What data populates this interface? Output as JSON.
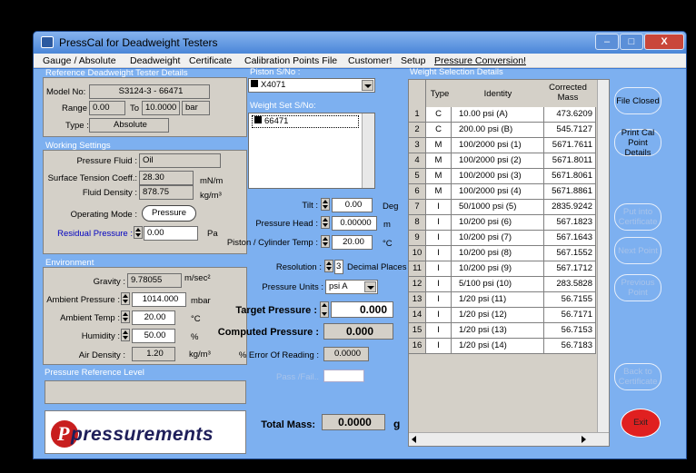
{
  "window": {
    "title": "PressCal  for Deadweight Testers",
    "controls": {
      "minimize": "–",
      "maximize": "□",
      "close": "X"
    }
  },
  "menu": [
    "Gauge / Absolute",
    "Deadweight",
    "Certificate",
    "Calibration Points File",
    "Customer!",
    "Setup",
    "Pressure Conversion!"
  ],
  "reference": {
    "section_title": "Reference Deadweight Tester Details",
    "model_label": "Model No:",
    "model_value": "S3124-3 - 66471",
    "range_label": "Range :",
    "range_from": "0.00",
    "range_to_label": "To",
    "range_to": "10.0000",
    "range_unit": "bar",
    "type_label": "Type :",
    "type_value": "Absolute"
  },
  "working": {
    "section_title": "Working Settings",
    "fluid_label": "Pressure Fluid :",
    "fluid_value": "Oil",
    "tension_label": "Surface Tension Coeff.:",
    "tension_value": "28.30",
    "tension_unit": "mN/m",
    "density_label": "Fluid Density :",
    "density_value": "878.75",
    "density_unit": "kg/m³",
    "mode_label": "Operating Mode :",
    "mode_value": "Pressure",
    "residual_label": "Residual Pressure :",
    "residual_value": "0.00",
    "residual_unit": "Pa"
  },
  "environment": {
    "section_title": "Environment",
    "gravity_label": "Gravity :",
    "gravity_value": "9.78055",
    "gravity_unit": "m/sec²",
    "amb_press_label": "Ambient Pressure :",
    "amb_press_value": "1014.000",
    "amb_press_unit": "mbar",
    "amb_temp_label": "Ambient Temp :",
    "amb_temp_value": "20.00",
    "amb_temp_unit": "°C",
    "humidity_label": "Humidity :",
    "humidity_value": "50.00",
    "humidity_unit": "%",
    "air_density_label": "Air Density :",
    "air_density_value": "1.20",
    "air_density_unit": "kg/m³"
  },
  "pressure_ref_level": {
    "section_title": "Pressure Reference Level",
    "value": ""
  },
  "logo": {
    "text": "pressurements",
    "initial": "P"
  },
  "piston": {
    "label": "Piston  S/No :",
    "value": "X4071",
    "weight_set_label": "Weight Set S/No:",
    "weight_set_item": "66471"
  },
  "params": {
    "tilt_label": "Tilt :",
    "tilt_value": "0.00",
    "tilt_unit": "Deg",
    "head_label": "Pressure Head :",
    "head_value": "0.00000",
    "head_unit": "m",
    "piston_temp_label": "Piston / Cylinder Temp :",
    "piston_temp_value": "20.00",
    "piston_temp_unit": "°C",
    "resolution_label": "Resolution :",
    "resolution_value": "3",
    "resolution_unit": "Decimal Places",
    "units_label": "Pressure Units :",
    "units_value": "psi A",
    "target_label": "Target Pressure :",
    "target_value": "0.000",
    "computed_label": "Computed Pressure :",
    "computed_value": "0.000",
    "error_label": "% Error Of Reading :",
    "error_value": "0.0000",
    "passfail_label": "Pass /Fail..",
    "total_label": "Total Mass:",
    "total_value": "0.0000",
    "total_unit": "g"
  },
  "weights": {
    "section_title": "Weight Selection Details",
    "headers": [
      "Type",
      "Identity",
      "Corrected Mass"
    ],
    "rows": [
      {
        "n": "1",
        "type": "C",
        "identity": "10.00 psi (A)",
        "mass": "473.6209"
      },
      {
        "n": "2",
        "type": "C",
        "identity": "200.00 psi (B)",
        "mass": "545.7127"
      },
      {
        "n": "3",
        "type": "M",
        "identity": "100/2000 psi (1)",
        "mass": "5671.7611"
      },
      {
        "n": "4",
        "type": "M",
        "identity": "100/2000 psi (2)",
        "mass": "5671.8011"
      },
      {
        "n": "5",
        "type": "M",
        "identity": "100/2000 psi (3)",
        "mass": "5671.8061"
      },
      {
        "n": "6",
        "type": "M",
        "identity": "100/2000 psi (4)",
        "mass": "5671.8861"
      },
      {
        "n": "7",
        "type": "I",
        "identity": "50/1000 psi (5)",
        "mass": "2835.9242"
      },
      {
        "n": "8",
        "type": "I",
        "identity": "10/200 psi (6)",
        "mass": "567.1823"
      },
      {
        "n": "9",
        "type": "I",
        "identity": "10/200 psi (7)",
        "mass": "567.1643"
      },
      {
        "n": "10",
        "type": "I",
        "identity": "10/200 psi (8)",
        "mass": "567.1552"
      },
      {
        "n": "11",
        "type": "I",
        "identity": "10/200 psi (9)",
        "mass": "567.1712"
      },
      {
        "n": "12",
        "type": "I",
        "identity": "5/100 psi (10)",
        "mass": "283.5828"
      },
      {
        "n": "13",
        "type": "I",
        "identity": "1/20 psi (11)",
        "mass": "56.7155"
      },
      {
        "n": "14",
        "type": "I",
        "identity": "1/20 psi (12)",
        "mass": "56.7171"
      },
      {
        "n": "15",
        "type": "I",
        "identity": "1/20 psi (13)",
        "mass": "56.7153"
      },
      {
        "n": "16",
        "type": "I",
        "identity": "1/20 psi (14)",
        "mass": "56.7183"
      }
    ]
  },
  "side_buttons": {
    "file": "File Closed",
    "print": "Print Cal Point Details",
    "put": "Put into Certificate",
    "next": "Next Point",
    "previous": "Previous Point",
    "back": "Back to Certificate",
    "exit": "Exit"
  },
  "colors": {
    "client_bg": "#7db0f0",
    "titlebar": "#4a86d8",
    "exit_button": "#e02020",
    "highlight_label": "#0000c0"
  }
}
